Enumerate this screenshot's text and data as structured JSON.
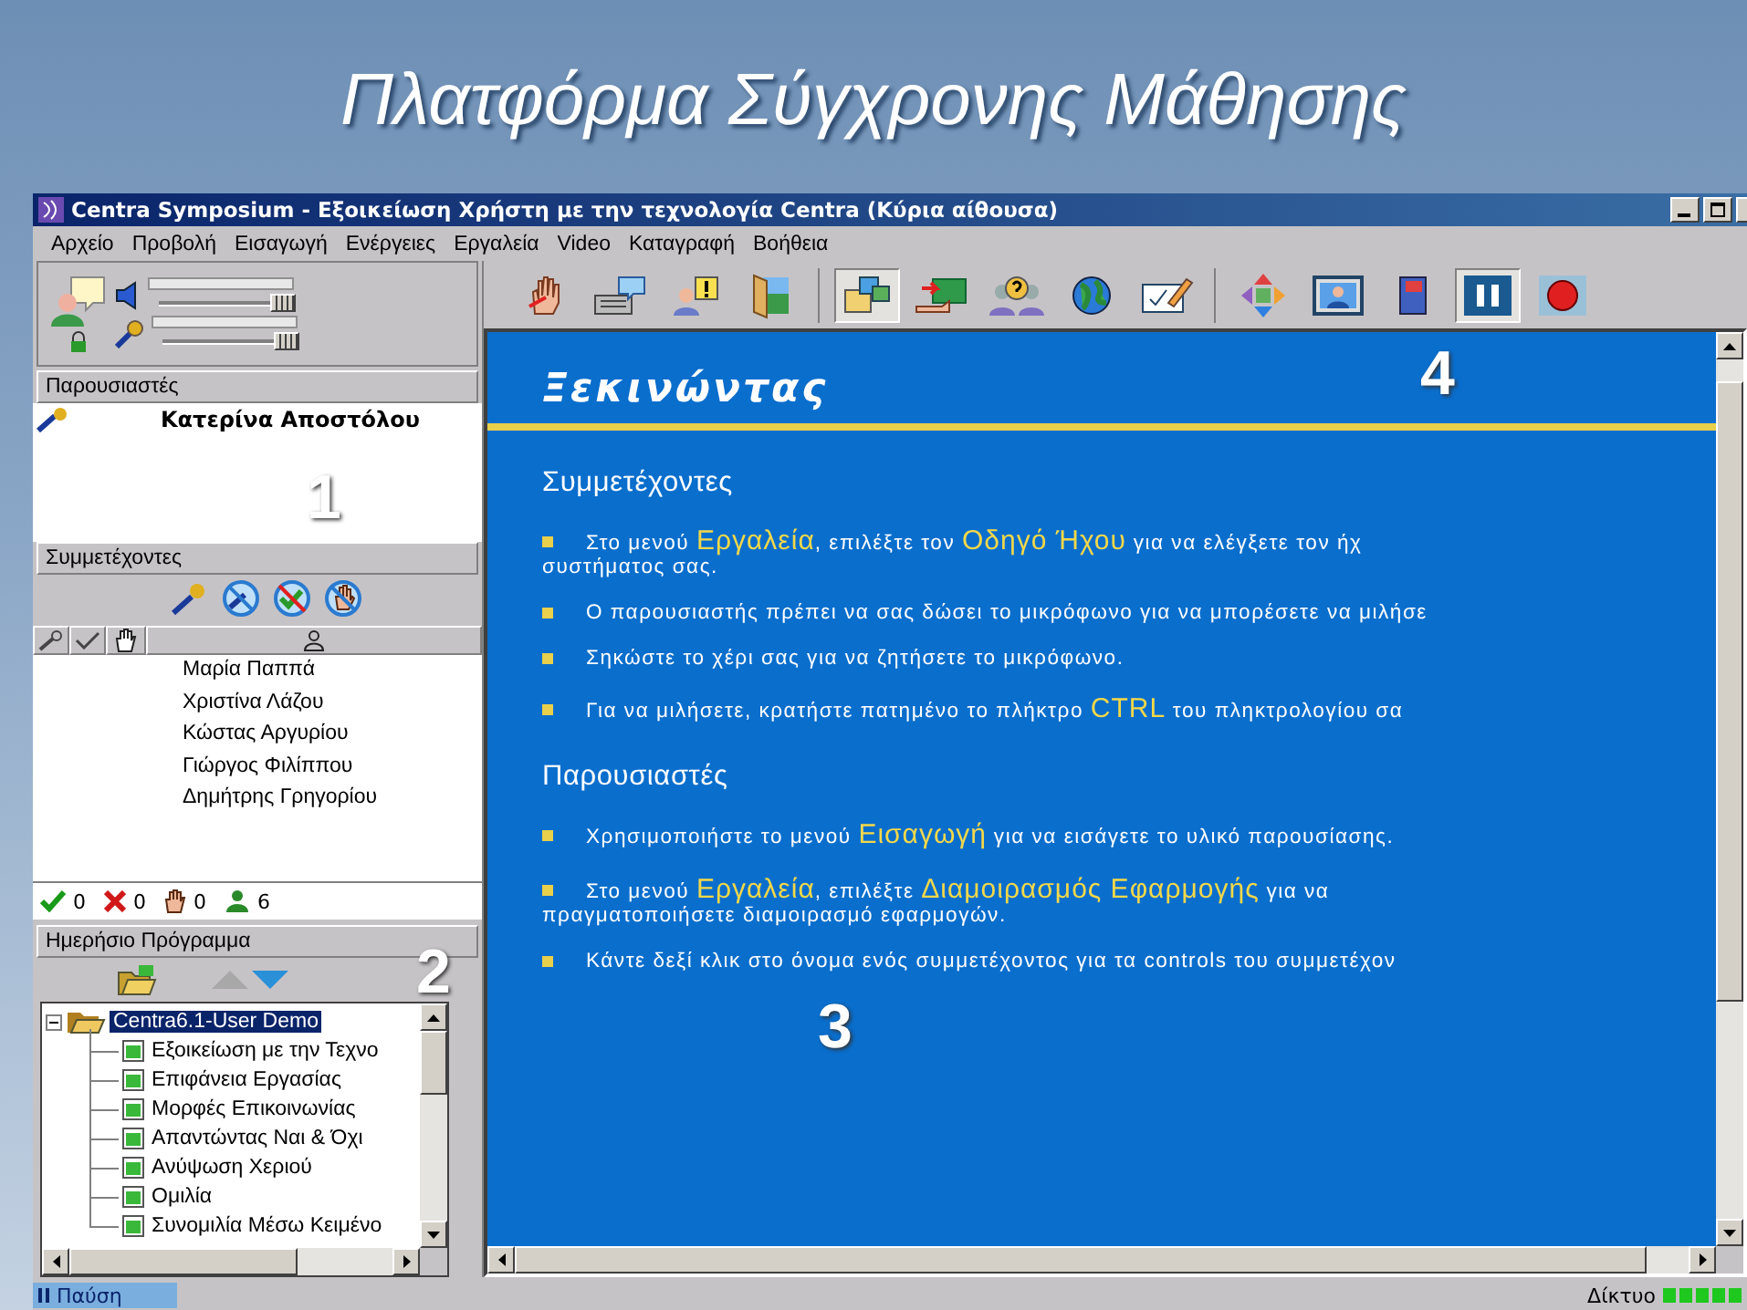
{
  "slide_title": "Πλατφόρμα Σύγχρονης Μάθησης",
  "window": {
    "title": "Centra Symposium - Εξοικείωση Χρήστη με την τεχνολογία Centra (Κύρια αίθουσα)"
  },
  "menu": [
    "Αρχείο",
    "Προβολή",
    "Εισαγωγή",
    "Ενέργειες",
    "Εργαλεία",
    "Video",
    "Καταγραφή",
    "Βοήθεια"
  ],
  "audio": {
    "sliders": [
      {
        "kind": "speaker",
        "level": 0.95
      },
      {
        "kind": "microphone",
        "level": 0.95
      }
    ]
  },
  "presenters": {
    "header": "Παρουσιαστές",
    "items": [
      "Κατερίνα Αποστόλου"
    ]
  },
  "participants": {
    "header": "Συμμετέχοντες",
    "items": [
      "Μαρία Παππά",
      "Χριστίνα Λάζου",
      "Κώστας Αργυρίου",
      "Γιώργος Φιλίππου",
      "Δημήτρης Γρηγορίου"
    ],
    "counts": [
      {
        "kind": "agree",
        "value": "0"
      },
      {
        "kind": "disagree",
        "value": "0"
      },
      {
        "kind": "hand",
        "value": "0"
      },
      {
        "kind": "people",
        "value": "6"
      }
    ]
  },
  "schedule": {
    "header": "Ημερήσιο Πρόγραμμα",
    "tree": [
      {
        "label": "Centra6.1-User Demo",
        "selected": true,
        "expanded": true,
        "children": [
          {
            "label": "Εξοικείωση με την Τεχνο"
          },
          {
            "label": "Επιφάνεια Εργασίας"
          },
          {
            "label": "Μορφές Επικοινωνίας"
          },
          {
            "label": "Απαντώντας Ναι & Όχι"
          },
          {
            "label": "Ανύψωση Χεριού"
          },
          {
            "label": "Ομιλία"
          },
          {
            "label": "Συνομιλία Μέσω Κειμένο"
          }
        ]
      }
    ]
  },
  "toolbar": [
    [
      {
        "kind": "hand",
        "pressed": false
      },
      {
        "kind": "chat",
        "pressed": false
      },
      {
        "kind": "alert",
        "pressed": false
      },
      {
        "kind": "door",
        "pressed": false
      }
    ],
    [
      {
        "kind": "windows",
        "pressed": true
      },
      {
        "kind": "share",
        "pressed": false
      },
      {
        "kind": "question",
        "pressed": false
      },
      {
        "kind": "globe",
        "pressed": false
      },
      {
        "kind": "whiteboard",
        "pressed": false
      }
    ],
    [
      {
        "kind": "arrows",
        "pressed": false
      },
      {
        "kind": "portrait",
        "pressed": false
      },
      {
        "kind": "book",
        "pressed": false
      },
      {
        "kind": "pause",
        "pressed": true
      },
      {
        "kind": "record",
        "pressed": false
      }
    ]
  ],
  "content": {
    "heading": "Ξεκινώντας",
    "sections": [
      {
        "title": "Συμμετέχοντες",
        "bullets": [
          [
            "Στο μενού **Εργαλεία**, επιλέξτε τον **Οδηγό Ήχου** για να ελέγξετε τον ήχ",
            "συστήματος σας."
          ],
          [
            "Ο παρουσιαστής πρέπει να σας δώσει το μικρόφωνο για να μπορέσετε να μιλήσε"
          ],
          [
            "Σηκώστε το χέρι σας για να ζητήσετε το μικρόφωνο."
          ],
          [
            "Για να μιλήσετε, κρατήστε πατημένο το πλήκτρο **CTRL** του πληκτρολογίου σα"
          ]
        ]
      },
      {
        "title": "Παρουσιαστές",
        "bullets": [
          [
            "Χρησιμοποιήστε το μενού **Εισαγωγή** για να εισάγετε το υλικό παρουσίασης."
          ],
          [
            "Στο μενού **Εργαλεία**, επιλέξτε **Διαμοιρασμός Εφαρμογής** για να",
            "πραγματοποιήσετε διαμοιρασμό εφαρμογών."
          ],
          [
            "Κάντε δεξί κλικ στο όνομα ενός συμμετέχοντος για τα controls του συμμετέχον"
          ]
        ]
      }
    ]
  },
  "status_bar": {
    "state": "Παύση",
    "network": "Δίκτυο"
  },
  "callouts": [
    "1",
    "2",
    "3",
    "4"
  ]
}
